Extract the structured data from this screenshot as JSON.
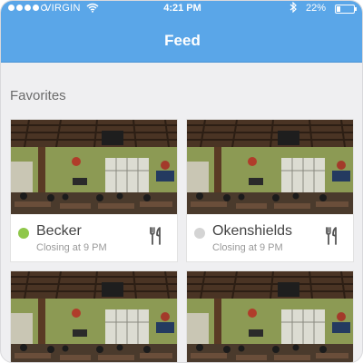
{
  "status_bar": {
    "carrier": "VIRGIN",
    "time": "4:21 PM",
    "battery_percent": "22%",
    "battery_level": 0.22
  },
  "nav": {
    "title": "Feed"
  },
  "favorites": {
    "title": "Favorites",
    "items": [
      {
        "name": "Becker",
        "status": "Closing at 9 PM",
        "status_color": "#8fc74a",
        "icon": "utensils-icon"
      },
      {
        "name": "Okenshields",
        "status": "Closing at 9 PM",
        "status_color": "#d4d4d4",
        "icon": "utensils-icon"
      }
    ]
  }
}
